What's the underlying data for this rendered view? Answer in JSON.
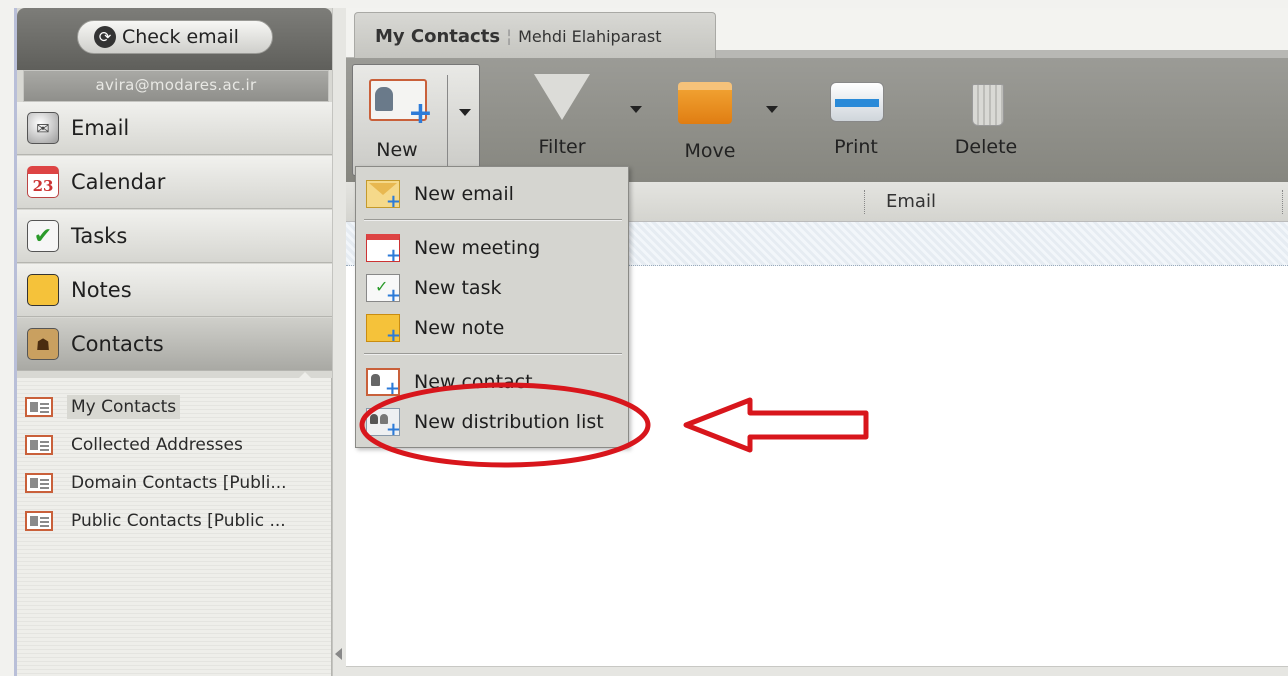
{
  "left_panel": {
    "check_email_label": "Check email",
    "account": "avira@modares.ac.ir",
    "nav": [
      {
        "label": "Email",
        "icon": "email-icon"
      },
      {
        "label": "Calendar",
        "icon": "calendar-icon",
        "calendar_day": "23"
      },
      {
        "label": "Tasks",
        "icon": "tasks-icon"
      },
      {
        "label": "Notes",
        "icon": "notes-icon"
      },
      {
        "label": "Contacts",
        "icon": "contacts-icon",
        "active": true
      }
    ],
    "folders": [
      {
        "label": "My Contacts",
        "selected": true
      },
      {
        "label": "Collected Addresses"
      },
      {
        "label": "Domain Contacts [Publi..."
      },
      {
        "label": "Public Contacts [Public ..."
      }
    ]
  },
  "tabs": {
    "main": "My Contacts",
    "sub": "Mehdi Elahiparast"
  },
  "toolbar": {
    "new": "New",
    "filter": "Filter",
    "move": "Move",
    "print": "Print",
    "delete": "Delete"
  },
  "list": {
    "column_email": "Email"
  },
  "new_menu": {
    "items": [
      {
        "label": "New email",
        "icon": "new-email-icon"
      },
      {
        "label": "New meeting",
        "icon": "new-meeting-icon"
      },
      {
        "label": "New task",
        "icon": "new-task-icon"
      },
      {
        "label": "New note",
        "icon": "new-note-icon"
      },
      {
        "label": "New contact",
        "icon": "new-contact-icon"
      },
      {
        "label": "New distribution list",
        "icon": "new-distribution-list-icon"
      }
    ]
  },
  "colors": {
    "annotation_red": "#d8161c",
    "accent_blue": "#2d7bd8"
  }
}
